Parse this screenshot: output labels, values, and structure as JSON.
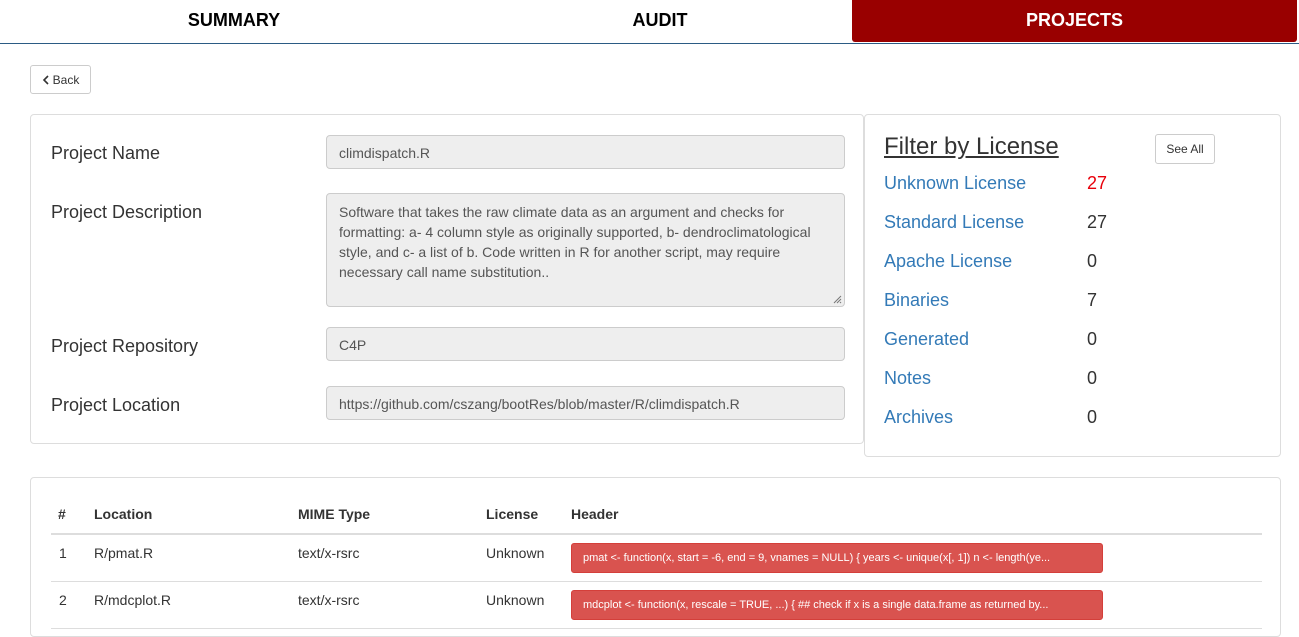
{
  "nav": {
    "tabs": [
      {
        "label": "SUMMARY"
      },
      {
        "label": "AUDIT"
      },
      {
        "label": "PROJECTS"
      }
    ]
  },
  "back_label": "Back",
  "project": {
    "name_label": "Project Name",
    "name_value": "climdispatch.R",
    "description_label": "Project Description",
    "description_value": "Software that takes the raw climate data as an argument and checks for formatting: a- 4 column style as originally supported, b- dendroclimatological style, and c- a list of b. Code written in R for another script, may require necessary call name substitution..",
    "repository_label": "Project Repository",
    "repository_value": "C4P",
    "location_label": "Project Location",
    "location_value": "https://github.com/cszang/bootRes/blob/master/R/climdispatch.R"
  },
  "license_filter": {
    "title": "Filter by License",
    "see_all_label": "See All",
    "items": [
      {
        "name": "Unknown License",
        "count": "27"
      },
      {
        "name": "Standard License",
        "count": "27"
      },
      {
        "name": "Apache License",
        "count": "0"
      },
      {
        "name": "Binaries",
        "count": "7"
      },
      {
        "name": "Generated",
        "count": "0"
      },
      {
        "name": "Notes",
        "count": "0"
      },
      {
        "name": "Archives",
        "count": "0"
      }
    ],
    "alert_color": "#e8000b",
    "link_color": "#337ab7"
  },
  "table": {
    "columns": [
      "#",
      "Location",
      "MIME Type",
      "License",
      "Header"
    ],
    "rows": [
      {
        "num": "1",
        "location": "R/pmat.R",
        "mime": "text/x-rsrc",
        "license": "Unknown",
        "header": "pmat <- function(x, start = -6, end = 9, vnames = NULL) { years <- unique(x[, 1]) n <- length(ye..."
      },
      {
        "num": "2",
        "location": "R/mdcplot.R",
        "mime": "text/x-rsrc",
        "license": "Unknown",
        "header": "mdcplot <- function(x, rescale = TRUE, ...) { ## check if x is a single data.frame as returned by..."
      }
    ]
  },
  "colors": {
    "active_tab": "#990000",
    "header_badge": "#d9534f"
  }
}
